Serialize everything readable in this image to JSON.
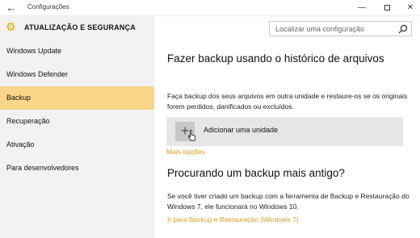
{
  "window": {
    "title": "Configurações",
    "back_icon": "arrow-left-icon",
    "controls": [
      "minimize-icon",
      "maximize-icon",
      "close-icon"
    ]
  },
  "header": {
    "section_title": "ATUALIZAÇÃO E SEGURANÇA",
    "icon": "gear-icon",
    "accent_color": "#e5a700"
  },
  "search": {
    "placeholder": "Localizar uma configuração",
    "value": ""
  },
  "sidebar": {
    "items": [
      {
        "label": "Windows Update",
        "active": false
      },
      {
        "label": "Windows Defender",
        "active": false
      },
      {
        "label": "Backup",
        "active": true
      },
      {
        "label": "Recuperação",
        "active": false
      },
      {
        "label": "Ativação",
        "active": false
      },
      {
        "label": "Para desenvolvedores",
        "active": false
      }
    ],
    "active_color": "#f9d68a"
  },
  "main": {
    "heading": "Fazer backup usando o histórico de arquivos",
    "description": "Faça backup dos seus arquivos em outra unidade e restaure-os se os originais forem perdidos, danificados ou excluídos.",
    "add_drive_label": "Adicionar uma unidade",
    "add_drive_icon": "plus-icon",
    "more_options_link": "Mais opções",
    "older_heading": "Procurando um backup mais antigo?",
    "older_description": "Se você tiver criado um backup com a ferramenta de Backup e Restauração do Windows 7, ele funcionará no Windows 10.",
    "restore_link": "Ir para Backup e Restauração (Windows 7)",
    "link_color": "#d99c1f"
  }
}
